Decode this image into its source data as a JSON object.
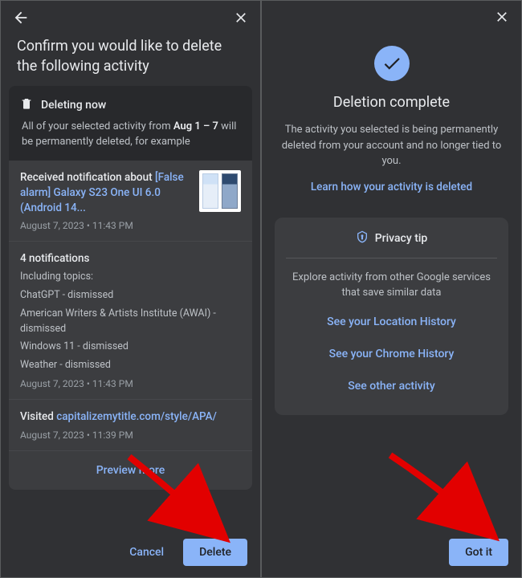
{
  "colors": {
    "accent": "#8ab4f8",
    "bg": "#303134",
    "card": "#3c3d40",
    "darkcard": "#28292c"
  },
  "left": {
    "title": "Confirm you would like to delete the following activity",
    "deleting_head": "Deleting now",
    "deleting_sub_pre": "All of your selected activity from ",
    "deleting_range": "Aug 1 – 7",
    "deleting_sub_post": " will be permanently deleted, for example",
    "item1_prefix": "Received notification about ",
    "item1_link": "[False alarm] Galaxy S23 One UI 6.0 (Android 14...",
    "item1_time": "August 7, 2023 • 11:43 PM",
    "item2_title": "4 notifications",
    "item2_including": "Including topics:",
    "item2_l1": "ChatGPT - dismissed",
    "item2_l2": "American Writers & Artists Institute (AWAI) - dismissed",
    "item2_l3": "Windows 11 - dismissed",
    "item2_l4": "Weather - dismissed",
    "item2_time": "August 7, 2023 • 11:43 PM",
    "item3_prefix": "Visited ",
    "item3_link": "capitalizemytitle.com/style/APA/",
    "item3_time": "August 7, 2023 • 11:39 PM",
    "preview_more": "Preview more",
    "cancel": "Cancel",
    "delete": "Delete"
  },
  "right": {
    "title": "Deletion complete",
    "body": "The activity you selected is being permanently deleted from your account and no longer tied to you.",
    "learn": "Learn how your activity is deleted",
    "tip_head": "Privacy tip",
    "tip_body": "Explore activity from other Google services that save similar data",
    "link1": "See your Location History",
    "link2": "See your Chrome History",
    "link3": "See other activity",
    "gotit": "Got it"
  }
}
